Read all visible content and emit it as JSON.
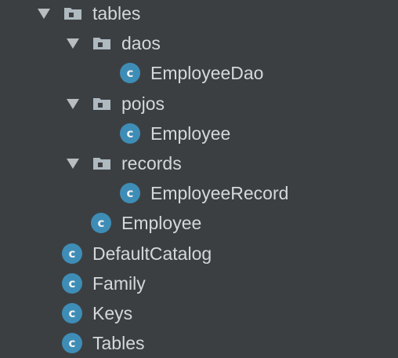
{
  "tree": {
    "items": [
      {
        "type": "folder",
        "label": "tables",
        "depth": 0,
        "expanded": true
      },
      {
        "type": "folder",
        "label": "daos",
        "depth": 1,
        "expanded": true
      },
      {
        "type": "class",
        "label": "EmployeeDao",
        "depth": 2
      },
      {
        "type": "folder",
        "label": "pojos",
        "depth": 1,
        "expanded": true
      },
      {
        "type": "class",
        "label": "Employee",
        "depth": 2
      },
      {
        "type": "folder",
        "label": "records",
        "depth": 1,
        "expanded": true
      },
      {
        "type": "class",
        "label": "EmployeeRecord",
        "depth": 2
      },
      {
        "type": "class",
        "label": "Employee",
        "depth": 1
      },
      {
        "type": "class",
        "label": "DefaultCatalog",
        "depth": 0
      },
      {
        "type": "class",
        "label": "Family",
        "depth": 0
      },
      {
        "type": "class",
        "label": "Keys",
        "depth": 0
      },
      {
        "type": "class",
        "label": "Tables",
        "depth": 0
      }
    ],
    "class_icon_letter": "c",
    "icons": {
      "expanded": "chevron-down-icon",
      "folder": "package-folder-icon",
      "class": "java-class-icon"
    }
  },
  "colors": {
    "background": "#3c3f41",
    "text": "#d5d8da",
    "class_icon": "#3e8db7",
    "folder_icon": "#aeb9c0",
    "folder_dot": "#3c3f41",
    "arrow": "#b9bdbf"
  }
}
